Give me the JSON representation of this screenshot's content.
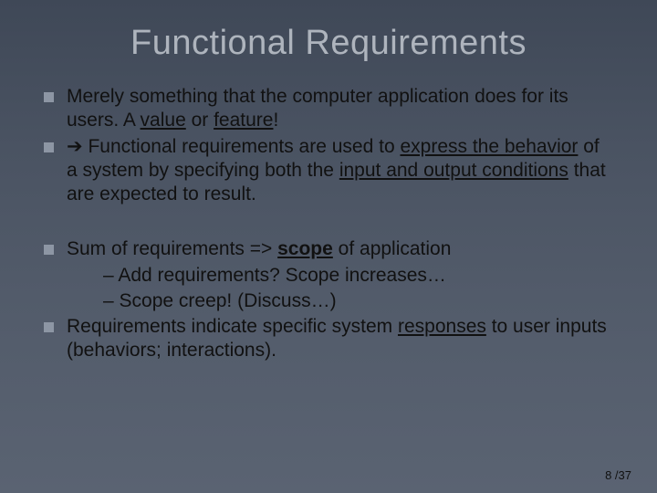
{
  "title": "Functional Requirements",
  "group1": {
    "b1_pre": "Merely something that the computer application does for its users.  A ",
    "b1_u1": "value",
    "b1_mid": " or ",
    "b1_u2": "feature",
    "b1_post": "!",
    "b2_arrow": "➔",
    "b2_pre": " Functional requirements are used to ",
    "b2_u1": "express the behavior",
    "b2_mid": " of a system by specifying both the ",
    "b2_u2": "input and output conditions",
    "b2_post": " that are expected to result."
  },
  "group2": {
    "b3_pre": "Sum of requirements => ",
    "b3_scope": "scope",
    "b3_post": " of application",
    "sub1": "– Add requirements?  Scope increases…",
    "sub2": "– Scope creep!  (Discuss…)",
    "b4_pre": "Requirements indicate specific system ",
    "b4_u1": "responses",
    "b4_post": " to user inputs (behaviors;  interactions)."
  },
  "pagenum": "8 /37"
}
